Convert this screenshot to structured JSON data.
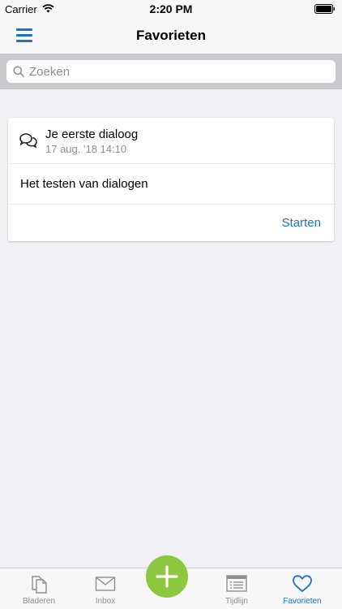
{
  "status_bar": {
    "carrier": "Carrier",
    "time": "2:20 PM"
  },
  "nav": {
    "title": "Favorieten",
    "menu_icon": "hamburger-menu-icon"
  },
  "search": {
    "placeholder": "Zoeken",
    "value": ""
  },
  "card": {
    "icon": "dialog-bubbles-icon",
    "title": "Je eerste dialoog",
    "date": "17 aug. '18 14:10",
    "description": "Het testen van dialogen",
    "action_label": "Starten"
  },
  "tabs": [
    {
      "label": "Bladeren",
      "icon": "documents-icon",
      "active": false
    },
    {
      "label": "Inbox",
      "icon": "envelope-icon",
      "active": false
    },
    {
      "label": "Tijdlijn",
      "icon": "timeline-icon",
      "active": false
    },
    {
      "label": "Favorieten",
      "icon": "heart-icon",
      "active": true
    }
  ],
  "colors": {
    "accent": "#1a73c9",
    "fab": "#8dc63f",
    "background": "#efeff4",
    "search_bar": "#c9c9ce"
  }
}
